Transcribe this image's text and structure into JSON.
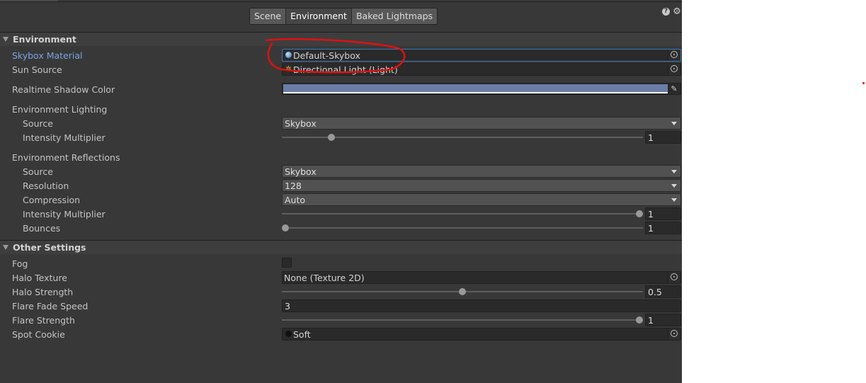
{
  "toolbar": {
    "tabs": [
      "Scene",
      "Environment",
      "Baked Lightmaps"
    ],
    "active_tab": "Environment",
    "help_icon": "help-icon",
    "settings_icon": "gear-icon"
  },
  "environment": {
    "title": "Environment",
    "skybox_material": {
      "label": "Skybox Material",
      "value": "Default-Skybox",
      "icon": "material-sphere-icon"
    },
    "sun_source": {
      "label": "Sun Source",
      "value": "Directional Light (Light)",
      "icon": "light-icon"
    },
    "realtime_shadow_color": {
      "label": "Realtime Shadow Color",
      "color": "#6a7ea7"
    },
    "environment_lighting": {
      "label": "Environment Lighting",
      "source": {
        "label": "Source",
        "value": "Skybox"
      },
      "intensity": {
        "label": "Intensity Multiplier",
        "value": "1",
        "slider_fraction": 0.13
      }
    },
    "environment_reflections": {
      "label": "Environment Reflections",
      "source": {
        "label": "Source",
        "value": "Skybox"
      },
      "resolution": {
        "label": "Resolution",
        "value": "128"
      },
      "compression": {
        "label": "Compression",
        "value": "Auto"
      },
      "intensity": {
        "label": "Intensity Multiplier",
        "value": "1",
        "slider_fraction": 1.0
      },
      "bounces": {
        "label": "Bounces",
        "value": "1",
        "slider_fraction": 0.0
      }
    }
  },
  "other_settings": {
    "title": "Other Settings",
    "fog": {
      "label": "Fog",
      "checked": false
    },
    "halo_texture": {
      "label": "Halo Texture",
      "value": "None (Texture 2D)"
    },
    "halo_strength": {
      "label": "Halo Strength",
      "value": "0.5",
      "slider_fraction": 0.5
    },
    "flare_fade_speed": {
      "label": "Flare Fade Speed",
      "value": "3"
    },
    "flare_strength": {
      "label": "Flare Strength",
      "value": "1",
      "slider_fraction": 1.0
    },
    "spot_cookie": {
      "label": "Spot Cookie",
      "value": "Soft",
      "icon": "texture-icon"
    }
  },
  "colors": {
    "panel_bg": "#383838",
    "highlight_label": "#7ba4df",
    "focus_border": "#3a79bb",
    "annotation": "#e01010"
  }
}
